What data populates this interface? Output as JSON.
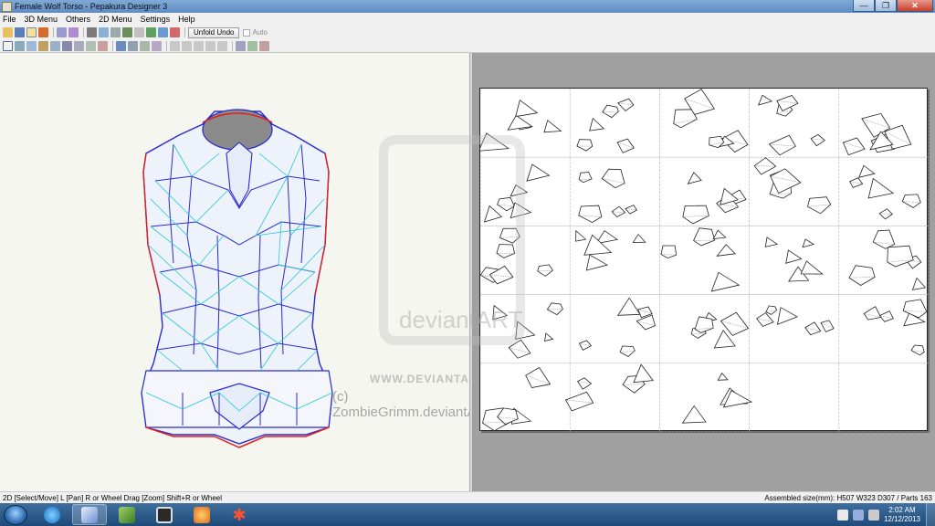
{
  "window": {
    "title": "Female Wolf Torso - Pepakura Designer 3"
  },
  "menu": {
    "items": [
      "File",
      "3D Menu",
      "Others",
      "2D Menu",
      "Settings",
      "Help"
    ]
  },
  "toolbar": {
    "unfold_undo_label": "Unfold Undo",
    "auto_label": "Auto"
  },
  "status": {
    "left": "2D [Select/Move] L [Pan] R or Wheel Drag [Zoom] Shift+R or Wheel",
    "right": "Assembled size(mm): H507 W323 D307 / Parts 163"
  },
  "watermark": {
    "brand": "deviantART",
    "url": "WWW.DEVIANTART.COM",
    "credit": "(c) ZombieGrimm.deviantART.com"
  },
  "taskbar": {
    "time": "2:02 AM",
    "date": "12/12/2013"
  },
  "colors": {
    "mesh": "#2a2ad0",
    "fold": "#25c8d8",
    "edge": "#e02020",
    "workspace": "#a0a0a0"
  }
}
